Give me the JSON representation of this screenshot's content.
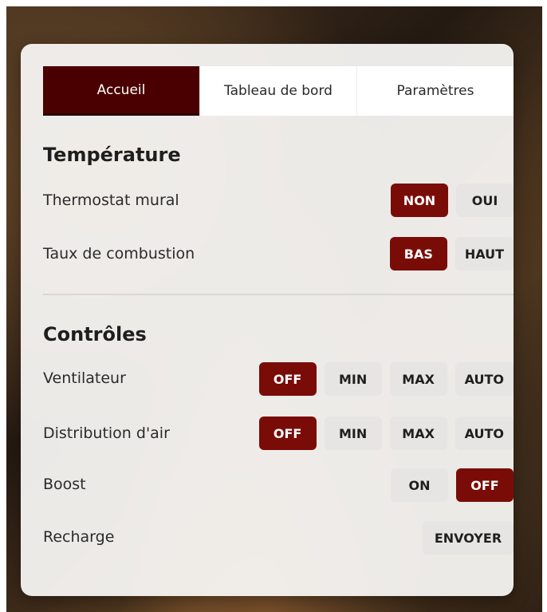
{
  "tabs": [
    {
      "label": "Accueil",
      "active": true
    },
    {
      "label": "Tableau de bord",
      "active": false
    },
    {
      "label": "Paramètres",
      "active": false
    }
  ],
  "temperature": {
    "title": "Température",
    "thermostat": {
      "label": "Thermostat mural",
      "options": [
        "NON",
        "OUI"
      ],
      "selected": "NON"
    },
    "combustion": {
      "label": "Taux de combustion",
      "options": [
        "BAS",
        "HAUT"
      ],
      "selected": "BAS"
    }
  },
  "controles": {
    "title": "Contrôles",
    "ventilateur": {
      "label": "Ventilateur",
      "options": [
        "OFF",
        "MIN",
        "MAX",
        "AUTO"
      ],
      "selected": "OFF"
    },
    "distribution": {
      "label": "Distribution d'air",
      "options": [
        "OFF",
        "MIN",
        "MAX",
        "AUTO"
      ],
      "selected": "OFF"
    },
    "boost": {
      "label": "Boost",
      "options": [
        "ON",
        "OFF"
      ],
      "selected": "OFF"
    },
    "recharge": {
      "label": "Recharge",
      "button": "ENVOYER"
    }
  },
  "colors": {
    "accent": "#7a0c08",
    "tab_active": "#4a0000",
    "button_idle": "#e6e5e4"
  }
}
